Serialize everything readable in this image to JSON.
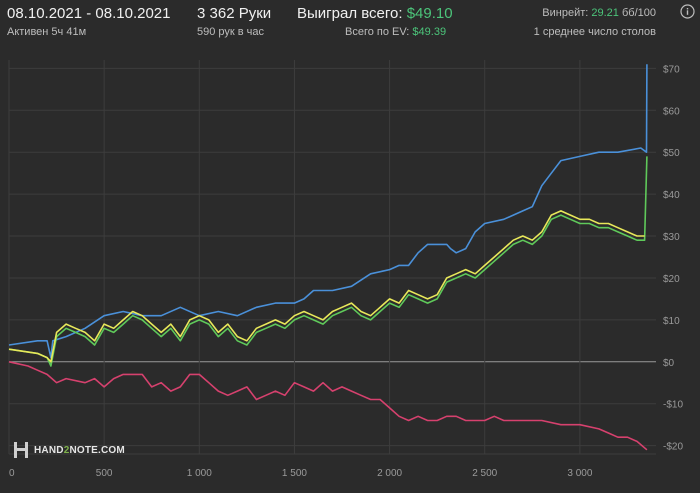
{
  "header": {
    "date_range": "08.10.2021 - 08.10.2021",
    "active": "Активен 5ч 41м",
    "hands": "3 362 Руки",
    "hands_per_hour": "590 рук в час",
    "won_label": "Выиграл всего:",
    "won_value": "$49.10",
    "ev_label": "Всего по EV:",
    "ev_value": "$49.39",
    "winrate_label": "Винрейт:",
    "winrate_value": "29.21",
    "winrate_unit": "бб/100",
    "avg_tables": "1 среднее число столов"
  },
  "logo": {
    "part1": "HAND",
    "part2": "2",
    "part3": "NOTE.COM"
  },
  "colors": {
    "blue": "#4a90d9",
    "green": "#5fc95a",
    "yellow": "#e8e85a",
    "pink": "#d6416e",
    "teal": "#3fa8a0",
    "background": "#2b2b2b"
  },
  "chart_data": {
    "type": "line",
    "xlim": [
      0,
      3400
    ],
    "ylim": [
      -22,
      72
    ],
    "x_ticks": [
      0,
      500,
      1000,
      1500,
      2000,
      2500,
      3000
    ],
    "x_tick_labels": [
      "0",
      "500",
      "1 000",
      "1 500",
      "2 000",
      "2 500",
      "3 000"
    ],
    "y_ticks": [
      70,
      60,
      50,
      40,
      30,
      20,
      10,
      0,
      -10,
      -20
    ],
    "y_tick_labels": [
      "$70",
      "$60",
      "$50",
      "$40",
      "$30",
      "$20",
      "$10",
      "$0",
      "-$10",
      "-$20"
    ],
    "series": [
      {
        "color": "#4a90d9",
        "x": [
          0,
          150,
          200,
          210,
          220,
          230,
          300,
          400,
          500,
          600,
          700,
          800,
          900,
          1000,
          1100,
          1200,
          1300,
          1400,
          1500,
          1550,
          1600,
          1700,
          1800,
          1900,
          2000,
          2050,
          2100,
          2150,
          2200,
          2300,
          2320,
          2350,
          2400,
          2450,
          2500,
          2600,
          2650,
          2700,
          2750,
          2800,
          2850,
          2900,
          3000,
          3100,
          3200,
          3320,
          3350,
          3352
        ],
        "y": [
          4,
          5,
          5,
          3,
          1,
          5,
          6,
          8,
          11,
          12,
          11,
          11,
          13,
          11,
          12,
          11,
          13,
          14,
          14,
          15,
          17,
          17,
          18,
          21,
          22,
          23,
          23,
          26,
          28,
          28,
          27,
          26,
          27,
          31,
          33,
          34,
          35,
          36,
          37,
          42,
          45,
          48,
          49,
          50,
          50,
          51,
          50,
          71
        ]
      },
      {
        "color": "#5fc95a",
        "x": [
          0,
          150,
          200,
          220,
          250,
          300,
          350,
          400,
          450,
          500,
          550,
          600,
          650,
          700,
          750,
          800,
          850,
          900,
          950,
          1000,
          1050,
          1100,
          1150,
          1200,
          1250,
          1300,
          1350,
          1400,
          1450,
          1500,
          1550,
          1600,
          1650,
          1700,
          1750,
          1800,
          1850,
          1900,
          1950,
          2000,
          2050,
          2100,
          2150,
          2200,
          2250,
          2300,
          2350,
          2400,
          2450,
          2500,
          2550,
          2600,
          2650,
          2700,
          2750,
          2800,
          2850,
          2900,
          2950,
          3000,
          3050,
          3100,
          3150,
          3200,
          3250,
          3300,
          3340,
          3352
        ],
        "y": [
          3,
          2,
          1,
          -1,
          6,
          8,
          7,
          6,
          4,
          8,
          7,
          9,
          11,
          10,
          8,
          6,
          8,
          5,
          9,
          10,
          9,
          6,
          8,
          5,
          4,
          7,
          8,
          9,
          8,
          10,
          11,
          10,
          9,
          11,
          12,
          13,
          11,
          10,
          12,
          14,
          13,
          16,
          15,
          14,
          15,
          19,
          20,
          21,
          20,
          22,
          24,
          26,
          28,
          29,
          28,
          30,
          34,
          35,
          34,
          33,
          33,
          32,
          32,
          31,
          30,
          29,
          29,
          49
        ]
      },
      {
        "color": "#e8e85a",
        "x": [
          0,
          150,
          200,
          220,
          250,
          300,
          350,
          400,
          450,
          500,
          550,
          600,
          650,
          700,
          750,
          800,
          850,
          900,
          950,
          1000,
          1050,
          1100,
          1150,
          1200,
          1250,
          1300,
          1350,
          1400,
          1450,
          1500,
          1550,
          1600,
          1650,
          1700,
          1750,
          1800,
          1850,
          1900,
          1950,
          2000,
          2050,
          2100,
          2150,
          2200,
          2250,
          2300,
          2350,
          2400,
          2450,
          2500,
          2550,
          2600,
          2650,
          2700,
          2750,
          2800,
          2850,
          2900,
          2950,
          3000,
          3050,
          3100,
          3150,
          3200,
          3250,
          3300,
          3340
        ],
        "y": [
          3,
          2,
          1,
          0,
          7,
          9,
          8,
          7,
          5,
          9,
          8,
          10,
          12,
          11,
          9,
          7,
          9,
          6,
          10,
          11,
          10,
          7,
          9,
          6,
          5,
          8,
          9,
          10,
          9,
          11,
          12,
          11,
          10,
          12,
          13,
          14,
          12,
          11,
          13,
          15,
          14,
          17,
          16,
          15,
          16,
          20,
          21,
          22,
          21,
          23,
          25,
          27,
          29,
          30,
          29,
          31,
          35,
          36,
          35,
          34,
          34,
          33,
          33,
          32,
          31,
          30,
          30
        ]
      },
      {
        "color": "#d6416e",
        "x": [
          0,
          100,
          150,
          200,
          250,
          300,
          400,
          450,
          500,
          550,
          600,
          700,
          750,
          800,
          850,
          900,
          950,
          1000,
          1050,
          1100,
          1150,
          1200,
          1250,
          1300,
          1350,
          1400,
          1450,
          1500,
          1550,
          1600,
          1650,
          1700,
          1750,
          1800,
          1850,
          1900,
          1950,
          2000,
          2050,
          2100,
          2150,
          2200,
          2250,
          2300,
          2350,
          2400,
          2500,
          2550,
          2600,
          2700,
          2800,
          2900,
          3000,
          3100,
          3150,
          3200,
          3250,
          3300,
          3352
        ],
        "y": [
          0,
          -1,
          -2,
          -3,
          -5,
          -4,
          -5,
          -4,
          -6,
          -4,
          -3,
          -3,
          -6,
          -5,
          -7,
          -6,
          -3,
          -3,
          -5,
          -7,
          -8,
          -7,
          -6,
          -9,
          -8,
          -7,
          -8,
          -5,
          -6,
          -7,
          -5,
          -7,
          -6,
          -7,
          -8,
          -9,
          -9,
          -11,
          -13,
          -14,
          -13,
          -14,
          -14,
          -13,
          -13,
          -14,
          -14,
          -13,
          -14,
          -14,
          -14,
          -15,
          -15,
          -16,
          -17,
          -18,
          -18,
          -19,
          -21
        ]
      }
    ]
  }
}
